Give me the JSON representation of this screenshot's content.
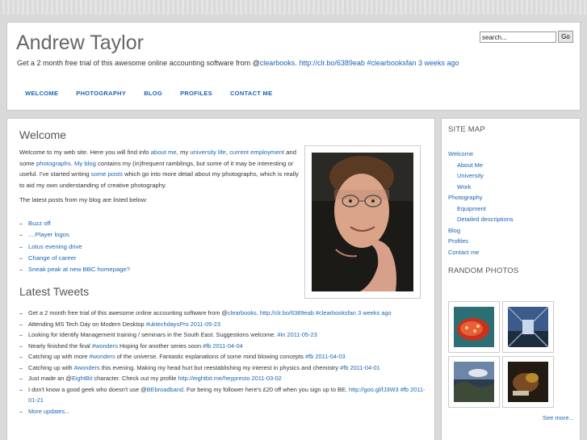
{
  "header": {
    "title": "Andrew Taylor",
    "tagline_text": "Get a 2 month free trial of this awesome online accounting software from @",
    "tagline_link1": "clearbooks",
    "tagline_sep": ". ",
    "tagline_link2": "http://clr.bo/6389eab",
    "tagline_space": " ",
    "tagline_link3": "#clearbooksfan",
    "tagline_space2": " ",
    "tagline_link4": "3 weeks ago",
    "search_value": "search...",
    "search_button": "Go"
  },
  "nav": [
    "WELCOME",
    "PHOTOGRAPHY",
    "BLOG",
    "PROFILES",
    "CONTACT ME"
  ],
  "welcome": {
    "title": "Welcome",
    "p1": {
      "t1": "Welcome to my web site. Here you will find info ",
      "l1": "about me",
      "t2": ", my ",
      "l2": "university life",
      "t3": ", ",
      "l3": "current employment",
      "t4": " and some ",
      "l4": "photographs",
      "t5": ". ",
      "l5": "My blog",
      "t6": " contains my (in)frequent ramblings, but some of it may be interesting or useful. I've started writing ",
      "l6": "some posts",
      "t7": " which go into more detail about my photographs, which is really to aid my own understanding of creative photography."
    },
    "p2": "The latest posts from my blog are listed below:",
    "posts": [
      "Buzz off",
      "....Player logos",
      "Lotus evening drive",
      "Change of career",
      "Sneak peak at new BBC homepage?"
    ]
  },
  "tweets": {
    "title": "Latest Tweets",
    "items": [
      {
        "parts": [
          [
            "t",
            "Get a 2 month free trial of this awesome online accounting software from @"
          ],
          [
            "l",
            "clearbooks"
          ],
          [
            "t",
            ". "
          ],
          [
            "l",
            "http://clr.bo/6389eab"
          ],
          [
            "t",
            " "
          ],
          [
            "l",
            "#clearbooksfan"
          ],
          [
            "t",
            " "
          ],
          [
            "l",
            "3 weeks ago"
          ]
        ]
      },
      {
        "parts": [
          [
            "t",
            "Attending MS Tech Day on Modern Desktop "
          ],
          [
            "l",
            "#uktechdaysPro"
          ],
          [
            "t",
            " "
          ],
          [
            "l",
            "2011-05-23"
          ]
        ]
      },
      {
        "parts": [
          [
            "t",
            "Looking for Identify Management training / seminars in the South East. Suggestions welcome. "
          ],
          [
            "l",
            "#in"
          ],
          [
            "t",
            " "
          ],
          [
            "l",
            "2011-05-23"
          ]
        ]
      },
      {
        "parts": [
          [
            "t",
            "Nearly finished the final "
          ],
          [
            "l",
            "#wonders"
          ],
          [
            "t",
            " Hoping for another series soon "
          ],
          [
            "l",
            "#fb"
          ],
          [
            "t",
            " "
          ],
          [
            "l",
            "2011-04-04"
          ]
        ]
      },
      {
        "parts": [
          [
            "t",
            "Catching up with more "
          ],
          [
            "l",
            "#wonders"
          ],
          [
            "t",
            " of the universe. Fantastic explanations of some mind blowing concepts "
          ],
          [
            "l",
            "#fb"
          ],
          [
            "t",
            " "
          ],
          [
            "l",
            "2011-04-03"
          ]
        ]
      },
      {
        "parts": [
          [
            "t",
            "Catching up with "
          ],
          [
            "l",
            "#wonders"
          ],
          [
            "t",
            " this evening. Making my head hurt but reestablishing my interest in physics and chemistry "
          ],
          [
            "l",
            "#fb"
          ],
          [
            "t",
            " "
          ],
          [
            "l",
            "2011-04-01"
          ]
        ]
      },
      {
        "parts": [
          [
            "t",
            "Just made an @"
          ],
          [
            "l",
            "EightBit"
          ],
          [
            "t",
            " character. Check out my profile "
          ],
          [
            "l",
            "http://eightbit.me/heypresto"
          ],
          [
            "t",
            " "
          ],
          [
            "l",
            "2011-03-02"
          ]
        ]
      },
      {
        "parts": [
          [
            "t",
            "I don't know a good geek who doesn't use @"
          ],
          [
            "l",
            "BEbroadband"
          ],
          [
            "t",
            ". For being my follower here's £20 off when you sign up to BE. "
          ],
          [
            "l",
            "http://goo.gl/fJ3W3"
          ],
          [
            "t",
            " "
          ],
          [
            "l",
            "#fb"
          ],
          [
            "t",
            " "
          ],
          [
            "l",
            "2011-01-21"
          ]
        ]
      },
      {
        "parts": [
          [
            "l",
            "More updates..."
          ]
        ]
      }
    ]
  },
  "sidebar": {
    "sitemap_title": "SITE MAP",
    "sitemap": [
      {
        "label": "Welcome",
        "sub": false
      },
      {
        "label": "About Me",
        "sub": true
      },
      {
        "label": "University",
        "sub": true
      },
      {
        "label": "Work",
        "sub": true
      },
      {
        "label": "Photography",
        "sub": false
      },
      {
        "label": "Equipment",
        "sub": true
      },
      {
        "label": "Detailed descriptions",
        "sub": true
      },
      {
        "label": "Blog",
        "sub": false
      },
      {
        "label": "Profiles",
        "sub": false
      },
      {
        "label": "Contact me",
        "sub": false
      }
    ],
    "random_title": "RANDOM PHOTOS",
    "see_more": "See more..."
  },
  "colors": {
    "link": "#1a64b4",
    "heading": "#555555",
    "background": "#d9d9d9"
  }
}
